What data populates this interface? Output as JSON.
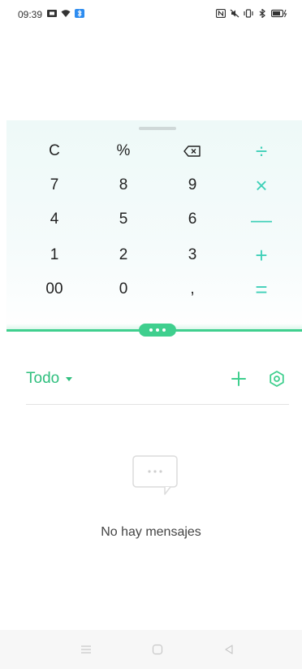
{
  "status_bar": {
    "time": "09:39",
    "left_icons": [
      "notification-icon",
      "wifi-icon",
      "bluetooth-badge-icon"
    ],
    "right_icons": [
      "nfc-icon",
      "mute-icon",
      "vibrate-icon",
      "bluetooth-icon",
      "battery-charging-icon"
    ]
  },
  "calculator": {
    "keys": [
      {
        "label": "C",
        "type": "function"
      },
      {
        "label": "%",
        "type": "function"
      },
      {
        "label": "",
        "icon": "backspace-icon",
        "type": "function"
      },
      {
        "label": "÷",
        "type": "operator"
      },
      {
        "label": "7",
        "type": "digit"
      },
      {
        "label": "8",
        "type": "digit"
      },
      {
        "label": "9",
        "type": "digit"
      },
      {
        "label": "×",
        "type": "operator"
      },
      {
        "label": "4",
        "type": "digit"
      },
      {
        "label": "5",
        "type": "digit"
      },
      {
        "label": "6",
        "type": "digit"
      },
      {
        "label": "—",
        "type": "operator"
      },
      {
        "label": "1",
        "type": "digit"
      },
      {
        "label": "2",
        "type": "digit"
      },
      {
        "label": "3",
        "type": "digit"
      },
      {
        "label": "+",
        "type": "operator"
      },
      {
        "label": "00",
        "type": "digit"
      },
      {
        "label": "0",
        "type": "digit"
      },
      {
        "label": ",",
        "type": "digit"
      },
      {
        "label": "=",
        "type": "operator"
      }
    ],
    "operator_color": "#3fd0b8",
    "accent_color": "#3fcf8e"
  },
  "messages": {
    "filter_label": "Todo",
    "empty_text": "No hay mensajes",
    "add_icon": "plus-icon",
    "settings_icon": "settings-icon",
    "empty_icon": "chat-bubble-icon"
  },
  "nav_bar": {
    "buttons": [
      "menu-icon",
      "home-icon",
      "back-icon"
    ]
  }
}
